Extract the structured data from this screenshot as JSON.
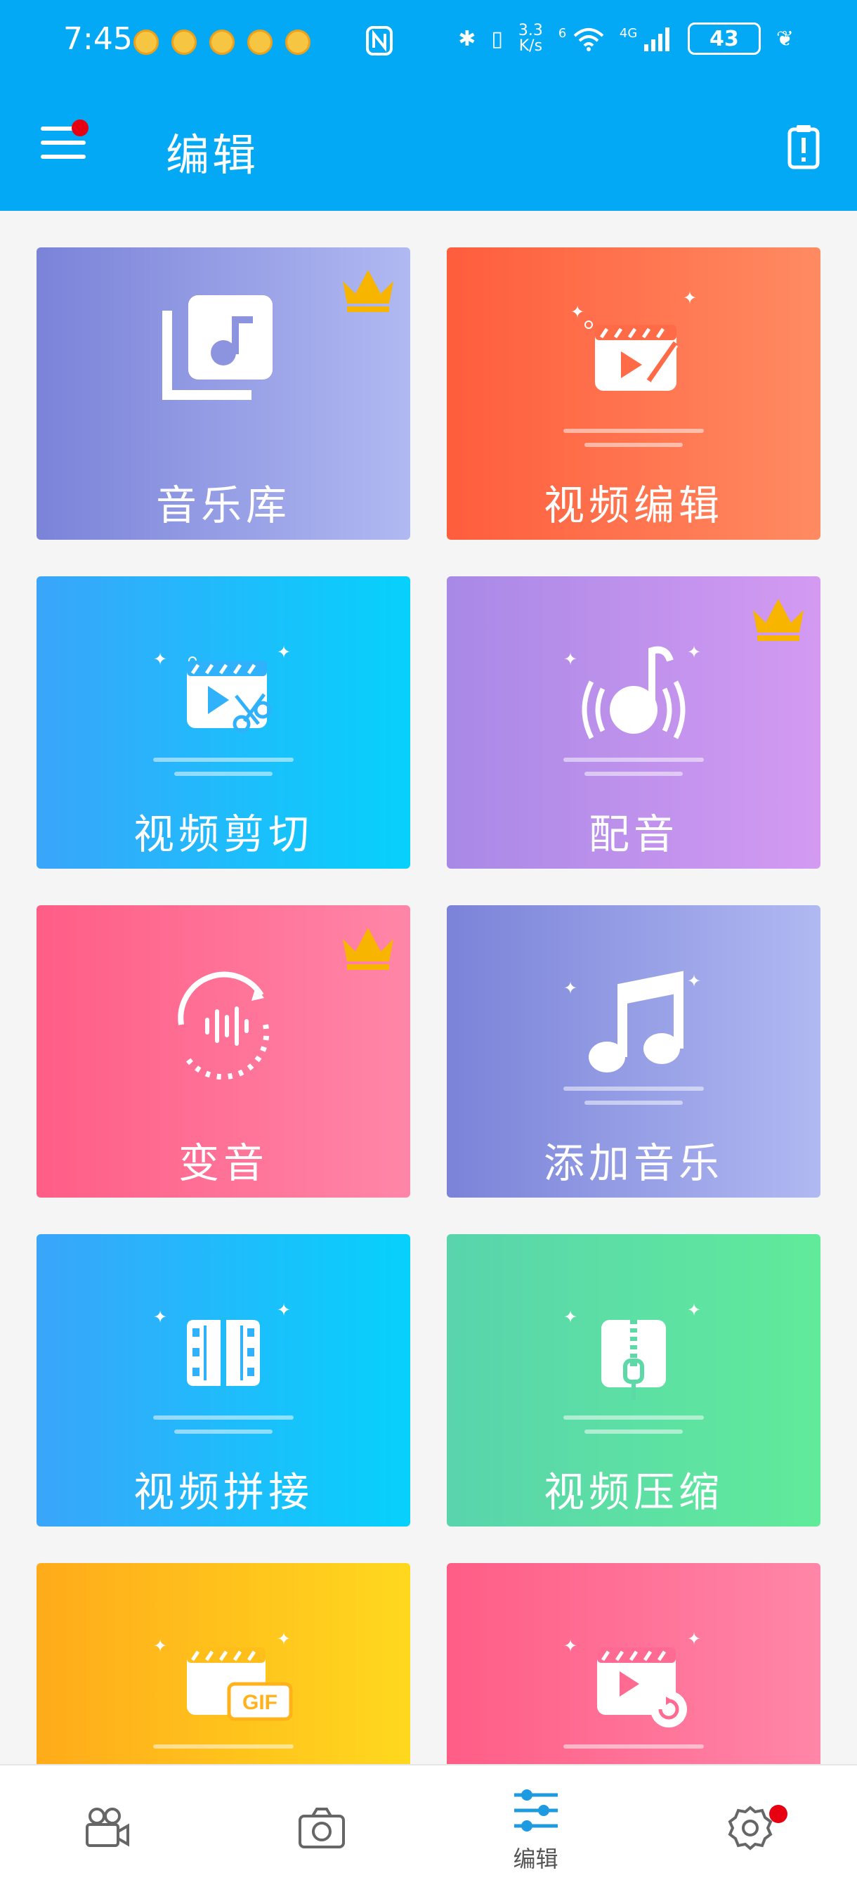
{
  "status_bar": {
    "time": "7:45",
    "speed_value": "3.3",
    "speed_unit": "K/s",
    "network": "4G",
    "wifi_badge": "6",
    "battery": "43"
  },
  "app_bar": {
    "title": "编辑"
  },
  "cards": [
    {
      "label": "音乐库",
      "icon": "music-library-icon",
      "premium": true
    },
    {
      "label": "视频编辑",
      "icon": "video-edit-icon",
      "premium": false
    },
    {
      "label": "视频剪切",
      "icon": "video-cut-icon",
      "premium": false
    },
    {
      "label": "配音",
      "icon": "dubbing-icon",
      "premium": true
    },
    {
      "label": "变音",
      "icon": "voice-change-icon",
      "premium": true
    },
    {
      "label": "添加音乐",
      "icon": "add-music-icon",
      "premium": false
    },
    {
      "label": "视频拼接",
      "icon": "video-merge-icon",
      "premium": false
    },
    {
      "label": "视频压缩",
      "icon": "video-compress-icon",
      "premium": false
    },
    {
      "label": "",
      "icon": "gif-icon",
      "badge": "GIF",
      "premium": false
    },
    {
      "label": "",
      "icon": "video-reverse-icon",
      "premium": false
    }
  ],
  "bottom_nav": {
    "items": [
      {
        "icon": "video-camera-icon",
        "label": ""
      },
      {
        "icon": "camera-icon",
        "label": ""
      },
      {
        "icon": "sliders-icon",
        "label": "编辑",
        "active": true
      },
      {
        "icon": "settings-icon",
        "label": ""
      }
    ]
  },
  "colors": {
    "primary": "#03a9f4",
    "crown": "#f7b500",
    "notification_dot": "#e60012"
  }
}
